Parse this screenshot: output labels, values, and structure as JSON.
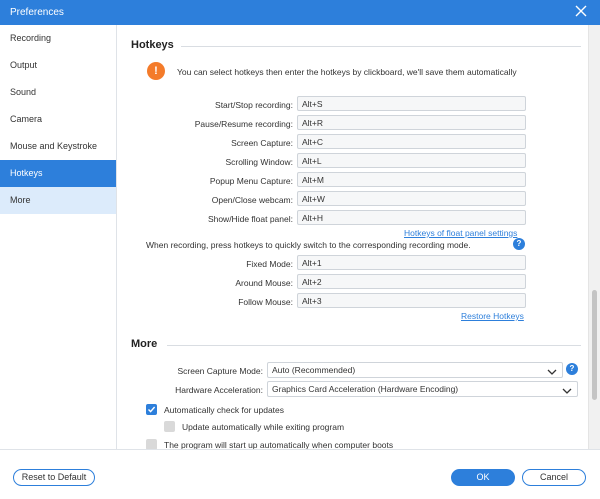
{
  "window": {
    "title": "Preferences",
    "close_icon": "close-icon"
  },
  "sidebar": {
    "items": [
      {
        "label": "Recording",
        "state": "normal"
      },
      {
        "label": "Output",
        "state": "normal"
      },
      {
        "label": "Sound",
        "state": "normal"
      },
      {
        "label": "Camera",
        "state": "normal"
      },
      {
        "label": "Mouse and Keystroke",
        "state": "normal"
      },
      {
        "label": "Hotkeys",
        "state": "active"
      },
      {
        "label": "More",
        "state": "hover"
      }
    ]
  },
  "hotkeys": {
    "title": "Hotkeys",
    "notice": "You can select hotkeys then enter the hotkeys by clickboard, we'll save them automatically",
    "items": [
      {
        "label": "Start/Stop recording:",
        "value": "Alt+S"
      },
      {
        "label": "Pause/Resume recording:",
        "value": "Alt+R"
      },
      {
        "label": "Screen Capture:",
        "value": "Alt+C"
      },
      {
        "label": "Scrolling Window:",
        "value": "Alt+L"
      },
      {
        "label": "Popup Menu Capture:",
        "value": "Alt+M"
      },
      {
        "label": "Open/Close webcam:",
        "value": "Alt+W"
      },
      {
        "label": "Show/Hide float panel:",
        "value": "Alt+H"
      }
    ],
    "float_panel_link": "Hotkeys of float panel settings",
    "mode_info": "When recording, press hotkeys to quickly switch to the corresponding recording mode.",
    "mode_items": [
      {
        "label": "Fixed Mode:",
        "value": "Alt+1"
      },
      {
        "label": "Around Mouse:",
        "value": "Alt+2"
      },
      {
        "label": "Follow Mouse:",
        "value": "Alt+3"
      }
    ],
    "restore_link": "Restore Hotkeys"
  },
  "more": {
    "title": "More",
    "screen_capture_mode": {
      "label": "Screen Capture Mode:",
      "value": "Auto (Recommended)"
    },
    "hardware_acceleration": {
      "label": "Hardware Acceleration:",
      "value": "Graphics Card Acceleration (Hardware Encoding)"
    },
    "checks": [
      {
        "label": "Automatically check for updates",
        "checked": true
      },
      {
        "label": "Update automatically while exiting program",
        "checked": false
      },
      {
        "label": "The program will start up automatically when computer boots",
        "checked": false
      }
    ]
  },
  "footer": {
    "reset_label": "Reset to Default",
    "ok_label": "OK",
    "cancel_label": "Cancel"
  },
  "colors": {
    "accent": "#2d7fdb",
    "warning": "#f47b2a",
    "sidebar_hover": "#dcebfb"
  }
}
